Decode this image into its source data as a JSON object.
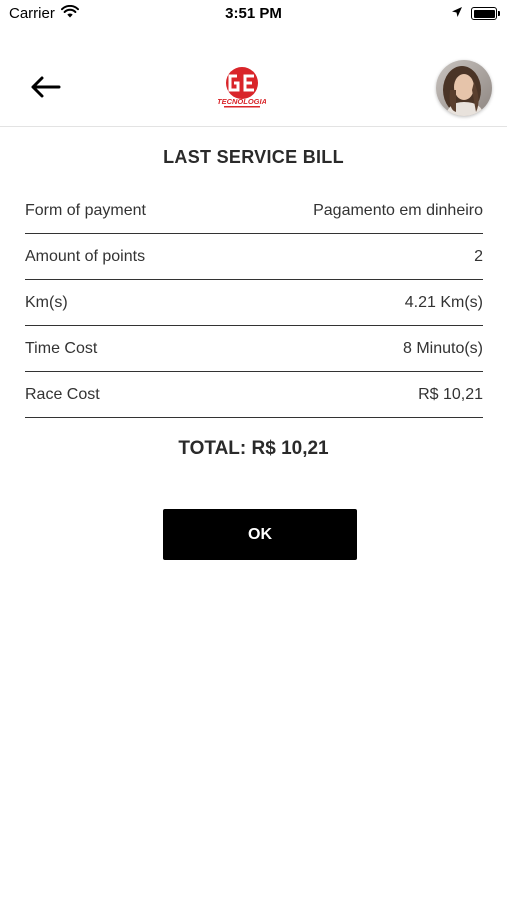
{
  "status_bar": {
    "carrier": "Carrier",
    "time": "3:51 PM"
  },
  "header": {
    "back_icon": "arrow-left-icon",
    "logo_icon": "brand-logo-ge",
    "logo_text": "TECNOLOGIA",
    "avatar_icon": "user-avatar"
  },
  "bill": {
    "title": "LAST SERVICE BILL",
    "rows": [
      {
        "label": "Form of payment",
        "value": "Pagamento em dinheiro"
      },
      {
        "label": "Amount of points",
        "value": "2"
      },
      {
        "label": "Km(s)",
        "value": "4.21 Km(s)"
      },
      {
        "label": "Time Cost",
        "value": "8 Minuto(s)"
      },
      {
        "label": "Race Cost",
        "value": "R$ 10,21"
      }
    ],
    "total": "TOTAL: R$ 10,21",
    "ok_label": "OK"
  },
  "colors": {
    "button_bg": "#000000",
    "logo_red": "#d9252a",
    "divider": "#333333"
  }
}
